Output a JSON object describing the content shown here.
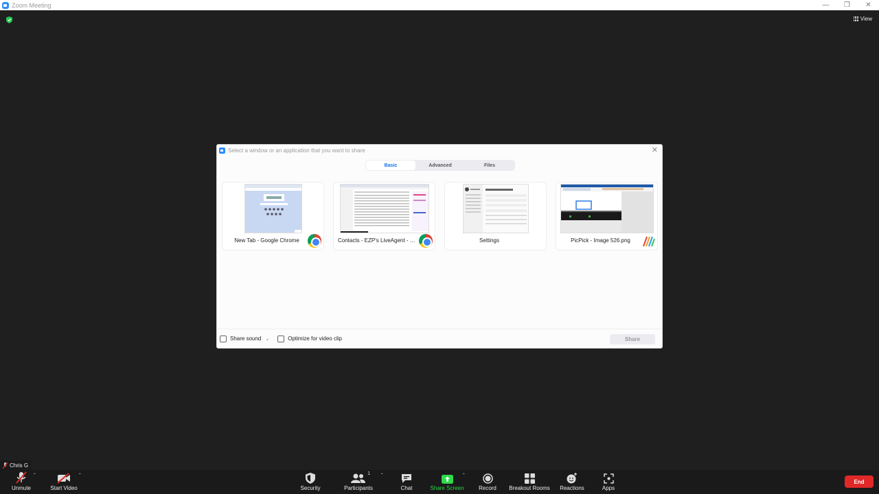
{
  "window": {
    "title": "Zoom Meeting",
    "controls": [
      "minimize",
      "restore",
      "close"
    ]
  },
  "top": {
    "view_label": "View"
  },
  "share_dialog": {
    "title": "Select a window or an application that you want to share",
    "tabs": [
      {
        "label": "Basic",
        "active": true
      },
      {
        "label": "Advanced",
        "active": false
      },
      {
        "label": "Files",
        "active": false
      }
    ],
    "items": [
      {
        "label": "New Tab - Google Chrome",
        "app_icon": "chrome-icon"
      },
      {
        "label": "Contacts - EZP's LiveAgent - Goo...",
        "app_icon": "chrome-icon"
      },
      {
        "label": "Settings",
        "app_icon": ""
      },
      {
        "label": "PicPick - Image 526.png",
        "app_icon": "picpick-icon"
      }
    ],
    "share_sound_label": "Share sound",
    "optimize_label": "Optimize for video clip",
    "share_button": "Share"
  },
  "participant": {
    "name": "Chris G"
  },
  "toolbar": {
    "unmute": "Unmute",
    "start_video": "Start Video",
    "security": "Security",
    "participants": "Participants",
    "participants_count": "1",
    "chat": "Chat",
    "share_screen": "Share Screen",
    "record": "Record",
    "breakout_rooms": "Breakout Rooms",
    "reactions": "Reactions",
    "apps": "Apps",
    "end": "End"
  },
  "colors": {
    "background": "#1f1f1f",
    "accent": "#0e72ed",
    "share_green": "#2fd94a",
    "end_red": "#e02828"
  }
}
